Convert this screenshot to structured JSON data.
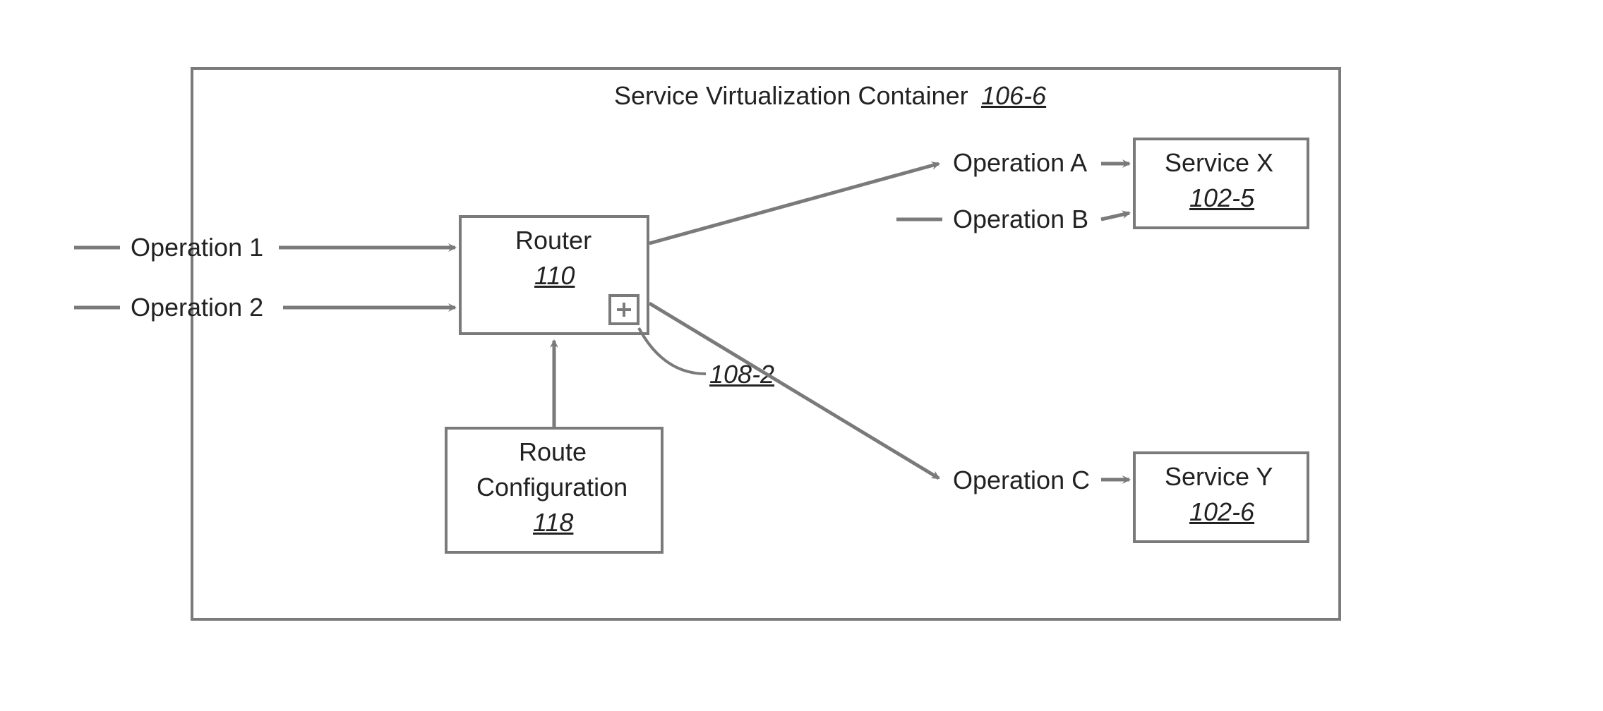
{
  "container": {
    "title": "Service Virtualization Container",
    "ref": "106-6"
  },
  "inputs": {
    "op1": "Operation 1",
    "op2": "Operation 2"
  },
  "router": {
    "title": "Router",
    "ref": "110",
    "plus_ref": "108-2"
  },
  "route_config": {
    "line1": "Route",
    "line2": "Configuration",
    "ref": "118"
  },
  "ops_right": {
    "a": "Operation A",
    "b": "Operation B",
    "c": "Operation C"
  },
  "service_x": {
    "title": "Service X",
    "ref": "102-5"
  },
  "service_y": {
    "title": "Service Y",
    "ref": "102-6"
  }
}
